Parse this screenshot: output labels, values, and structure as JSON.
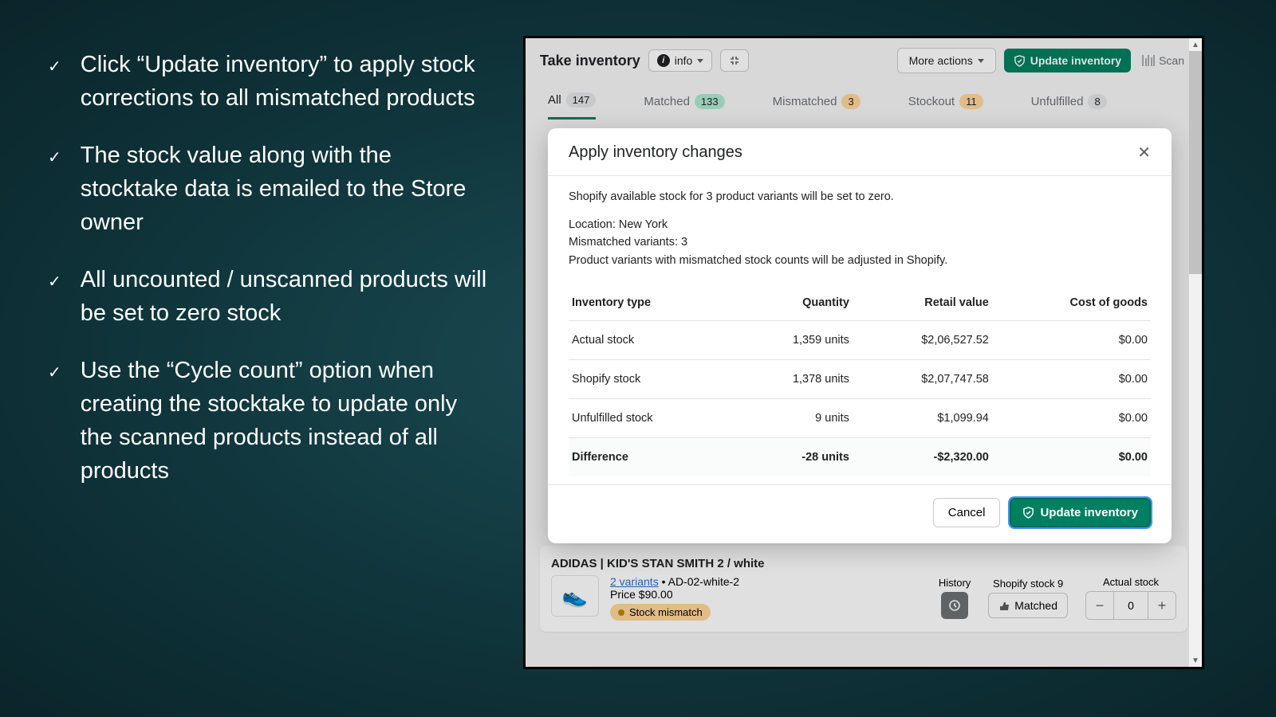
{
  "bullets": [
    "Click “Update inventory” to apply stock corrections to all mismatched products",
    "The stock value along with the stocktake data is emailed to the Store owner",
    "All uncounted / unscanned products will be set to zero stock",
    "Use the “Cycle count” option when creating the stocktake to update only the scanned products instead of all products"
  ],
  "app": {
    "title": "Take inventory",
    "info_label": "info",
    "more_actions": "More actions",
    "update_inventory": "Update inventory",
    "scan": "Scan"
  },
  "tabs": [
    {
      "label": "All",
      "count": "147",
      "badge": "grey",
      "active": true
    },
    {
      "label": "Matched",
      "count": "133",
      "badge": "green"
    },
    {
      "label": "Mismatched",
      "count": "3",
      "badge": "yellow"
    },
    {
      "label": "Stockout",
      "count": "11",
      "badge": "yellow"
    },
    {
      "label": "Unfulfilled",
      "count": "8",
      "badge": "grey"
    }
  ],
  "product": {
    "title": "ADIDAS | KID'S STAN SMITH 2 / white",
    "variants_link": "2 variants",
    "sku_suffix": " • AD-02-white-2",
    "price": "Price $90.00",
    "mismatch": "Stock mismatch",
    "history": "History",
    "shopify_stock_label": "Shopify stock",
    "shopify_stock_value": "9",
    "actual_stock_label": "Actual stock",
    "matched_label": "Matched",
    "stepper_value": "0"
  },
  "modal": {
    "title": "Apply inventory changes",
    "desc": "Shopify available stock for 3 product variants will be set to zero.",
    "location": "Location: New York",
    "mismatched": "Mismatched variants: 3",
    "adjust_note": "Product variants with mismatched stock counts will be adjusted in Shopify.",
    "headers": {
      "type": "Inventory type",
      "qty": "Quantity",
      "retail": "Retail value",
      "cost": "Cost of goods"
    },
    "rows": [
      {
        "type": "Actual stock",
        "qty": "1,359 units",
        "retail": "$2,06,527.52",
        "cost": "$0.00"
      },
      {
        "type": "Shopify stock",
        "qty": "1,378 units",
        "retail": "$2,07,747.58",
        "cost": "$0.00"
      },
      {
        "type": "Unfulfilled stock",
        "qty": "9 units",
        "retail": "$1,099.94",
        "cost": "$0.00"
      }
    ],
    "diff": {
      "type": "Difference",
      "qty": "-28 units",
      "retail": "-$2,320.00",
      "cost": "$0.00"
    },
    "cancel": "Cancel",
    "confirm": "Update inventory"
  }
}
